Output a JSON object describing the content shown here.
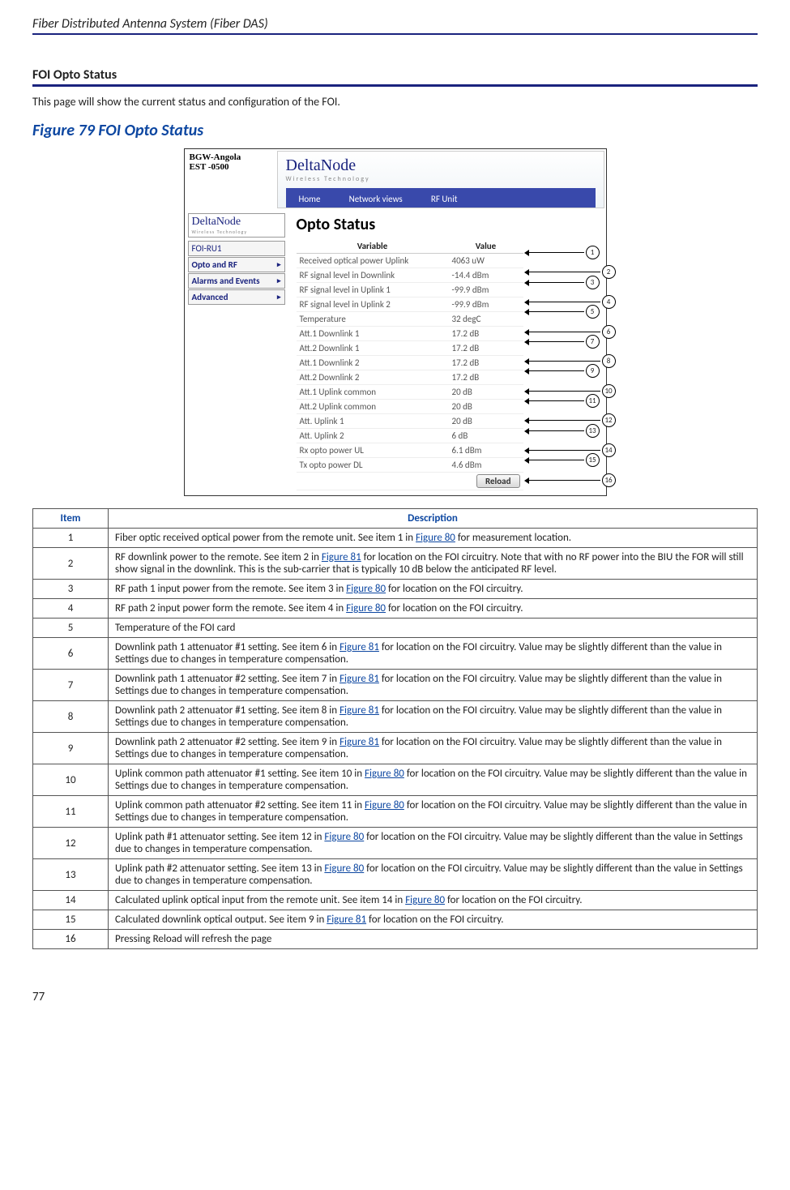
{
  "header": "Fiber Distributed Antenna System (Fiber DAS)",
  "section_title": "FOI Opto Status",
  "intro": "This page will show the current status and configuration of the FOI.",
  "figure_label": "Figure 79    FOI Opto Status",
  "page_num": "77",
  "figure": {
    "bgw_l1": "BGW-Angola",
    "bgw_l2": "EST -0500",
    "logo": "DeltaNode",
    "logo_sub": "Wireless   Technology",
    "tabs": [
      "Home",
      "Network views",
      "RF Unit"
    ],
    "sidebar_title": "FOI-RU1",
    "sidebar": [
      "Opto and RF",
      "Alarms and Events",
      "Advanced"
    ],
    "opto_title": "Opto Status",
    "th_var": "Variable",
    "th_val": "Value",
    "rows": [
      {
        "v": "Received optical power Uplink",
        "val": "4063 uW"
      },
      {
        "v": "RF signal level in Downlink",
        "val": "-14.4 dBm"
      },
      {
        "v": "RF signal level in Uplink 1",
        "val": "-99.9 dBm"
      },
      {
        "v": "RF signal level in Uplink 2",
        "val": "-99.9 dBm"
      },
      {
        "v": "Temperature",
        "val": "32 degC"
      },
      {
        "v": "Att.1 Downlink 1",
        "val": "17.2 dB"
      },
      {
        "v": "Att.2 Downlink 1",
        "val": "17.2 dB"
      },
      {
        "v": "Att.1 Downlink 2",
        "val": "17.2 dB"
      },
      {
        "v": "Att.2 Downlink 2",
        "val": "17.2 dB"
      },
      {
        "v": "Att.1 Uplink common",
        "val": "20 dB"
      },
      {
        "v": "Att.2 Uplink common",
        "val": "20 dB"
      },
      {
        "v": "Att. Uplink 1",
        "val": "20 dB"
      },
      {
        "v": "Att. Uplink 2",
        "val": "6 dB"
      },
      {
        "v": "Rx opto power UL",
        "val": "6.1 dBm"
      },
      {
        "v": "Tx opto power DL",
        "val": "4.6 dBm"
      }
    ],
    "reload": "Reload"
  },
  "table": {
    "th_item": "Item",
    "th_desc": "Description",
    "rows": [
      {
        "n": "1",
        "pre": "Fiber optic received optical power from the remote unit. See item 1 in ",
        "link": "Figure 80",
        "post": " for measurement location."
      },
      {
        "n": "2",
        "pre": "RF downlink power to the remote. See item 2 in ",
        "link": "Figure 81",
        "post": " for location on the FOI circuitry. Note that with no RF power into the BIU the FOR will still show signal in the downlink. This is the sub-carrier that is typically 10 dB below the anticipated RF level."
      },
      {
        "n": "3",
        "pre": "RF path 1 input power from the remote. See item 3 in ",
        "link": "Figure 80",
        "post": " for location on the FOI circuitry."
      },
      {
        "n": "4",
        "pre": "RF path 2 input power form the remote. See item 4 in ",
        "link": "Figure 80",
        "post": " for location on the FOI circuitry."
      },
      {
        "n": "5",
        "pre": "Temperature of the FOI card",
        "link": "",
        "post": ""
      },
      {
        "n": "6",
        "pre": "Downlink path 1 attenuator #1 setting. See item 6 in ",
        "link": "Figure 81",
        "post": " for location on the FOI circuitry. Value may be slightly different than the value in Settings due to changes in temperature compensation."
      },
      {
        "n": "7",
        "pre": "Downlink path 1 attenuator #2 setting. See item 7 in ",
        "link": "Figure 81",
        "post": " for location on the FOI circuitry. Value may be slightly different than the value in Settings due to changes in temperature compensation."
      },
      {
        "n": "8",
        "pre": "Downlink path 2 attenuator #1 setting. See item 8 in ",
        "link": "Figure 81",
        "post": " for location on the FOI circuitry. Value may be slightly different than the value in Settings due to changes in temperature compensation."
      },
      {
        "n": "9",
        "pre": "Downlink path 2 attenuator #2 setting. See item 9 in ",
        "link": "Figure 81",
        "post": " for location on the FOI circuitry. Value may be slightly different than the value in Settings due to changes in temperature compensation."
      },
      {
        "n": "10",
        "pre": "Uplink common path attenuator #1 setting. See item 10 in ",
        "link": "Figure 80",
        "post": " for location on the FOI circuitry. Value may be slightly different than the value in Settings due to changes in temperature compensation."
      },
      {
        "n": "11",
        "pre": "Uplink common path attenuator #2 setting. See item 11 in ",
        "link": "Figure 80",
        "post": " for location on the FOI circuitry. Value may be slightly different than the value in Settings due to changes in temperature compensation."
      },
      {
        "n": "12",
        "pre": "Uplink path #1 attenuator setting. See item 12 in ",
        "link": "Figure 80",
        "post": " for location on the FOI circuitry. Value may be slightly different than the value in Settings due to changes in temperature compensation."
      },
      {
        "n": "13",
        "pre": "Uplink path #2 attenuator setting. See item 13 in ",
        "link": "Figure 80",
        "post": " for location on the FOI circuitry. Value may be slightly different than the value in Settings due to changes in temperature compensation."
      },
      {
        "n": "14",
        "pre": "Calculated uplink optical input from the remote unit. See item 14 in ",
        "link": "Figure 80",
        "post": " for location on the FOI circuitry."
      },
      {
        "n": "15",
        "pre": "Calculated downlink optical output. See item 9 in ",
        "link": "Figure 81",
        "post": " for location on the FOI circuitry."
      },
      {
        "n": "16",
        "pre": "Pressing Reload will refresh the page",
        "link": "",
        "post": ""
      }
    ]
  }
}
